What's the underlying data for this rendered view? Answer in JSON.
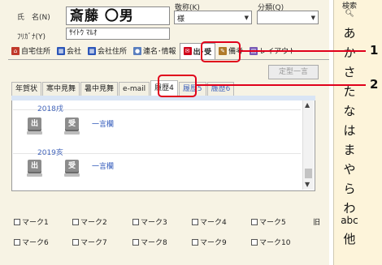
{
  "form": {
    "name_label": "氏　名(N)",
    "name_value": "斎藤 〇男",
    "furigana_label": "ﾌﾘｶﾞﾅ(Y)",
    "furigana_value": "ｻｲﾄｳ ﾏﾙｵ",
    "honorific_label": "敬称(K)",
    "honorific_value": "様",
    "category_label": "分類(Q)",
    "category_value": ""
  },
  "top_tabs": [
    {
      "label": "自宅住所",
      "icon": "home-icon",
      "color": "#c0392b"
    },
    {
      "label": "会社",
      "icon": "building-icon",
      "color": "#2c56b9"
    },
    {
      "label": "会社住所",
      "icon": "building-address-icon",
      "color": "#2c56b9"
    },
    {
      "label": "連名･情報",
      "icon": "people-icon",
      "color": "#5a7fbf"
    },
    {
      "label": "出･受",
      "icon": "send-receive-icon",
      "color": "#d0021b"
    },
    {
      "label": "備考",
      "icon": "notes-icon",
      "color": "#b07a2a"
    },
    {
      "label": "レイアウト",
      "icon": "layout-icon",
      "color": "#7a5ab5"
    }
  ],
  "teikei_button": "定型一言",
  "history_tabs": [
    "年賀状",
    "寒中見舞",
    "暑中見舞",
    "e-mail",
    "履歴4",
    "履歴5",
    "履歴6"
  ],
  "history_entries": [
    {
      "year": "2018戌",
      "send_stamp": "出",
      "receive_stamp": "受",
      "link": "一言欄"
    },
    {
      "year": "2019亥",
      "send_stamp": "出",
      "receive_stamp": "受",
      "link": "一言欄"
    }
  ],
  "marks_row1": [
    "マーク1",
    "マーク2",
    "マーク3",
    "マーク4",
    "マーク5"
  ],
  "marks_row2": [
    "マーク6",
    "マーク7",
    "マーク8",
    "マーク9",
    "マーク10"
  ],
  "mark_extra": "旧",
  "index_panel": {
    "search_label": "検索",
    "search_icon": "search-icon",
    "kana": [
      "あ",
      "か",
      "さ",
      "た",
      "な",
      "は",
      "ま",
      "や",
      "ら",
      "わ",
      "abc",
      "他"
    ]
  },
  "callouts": [
    "1",
    "2"
  ],
  "colors": {
    "callout": "#e0001b",
    "link": "#2c56b9"
  }
}
